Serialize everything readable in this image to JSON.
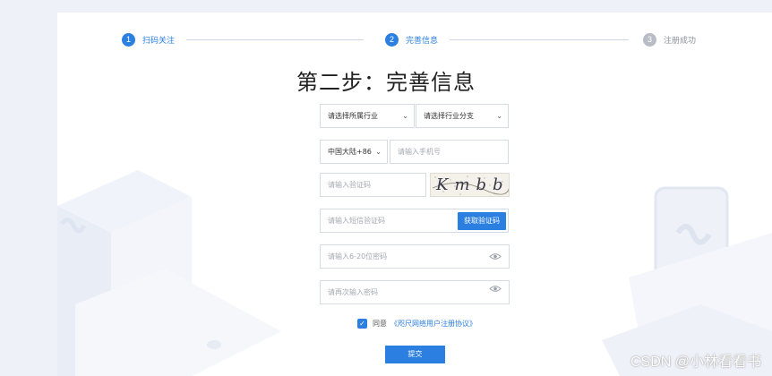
{
  "steps": [
    {
      "num": "1",
      "label": "扫码关注",
      "state": "active"
    },
    {
      "num": "2",
      "label": "完善信息",
      "state": "active"
    },
    {
      "num": "3",
      "label": "注册成功",
      "state": "inactive"
    }
  ],
  "title": "第二步：完善信息",
  "form": {
    "industry_select": "请选择所属行业",
    "industry_sub_select": "请选择行业分支",
    "country_code_select": "中国大陆+86",
    "phone_placeholder": "请输入手机号",
    "captcha_placeholder": "请输入验证码",
    "captcha_text": "Kmbb",
    "sms_code_placeholder": "请输入短信验证码",
    "sms_button": "获取验证码",
    "password_placeholder": "请输入6-20位密码",
    "password_confirm_placeholder": "请再次输入密码",
    "agree_text": "同意",
    "agreement_link": "《咫尺网络用户注册协议》",
    "submit_button": "提交"
  },
  "watermark": "CSDN @小林看看书",
  "colors": {
    "accent": "#2b7fe0",
    "inactive": "#b8bcc4",
    "background": "#eef1f8"
  }
}
